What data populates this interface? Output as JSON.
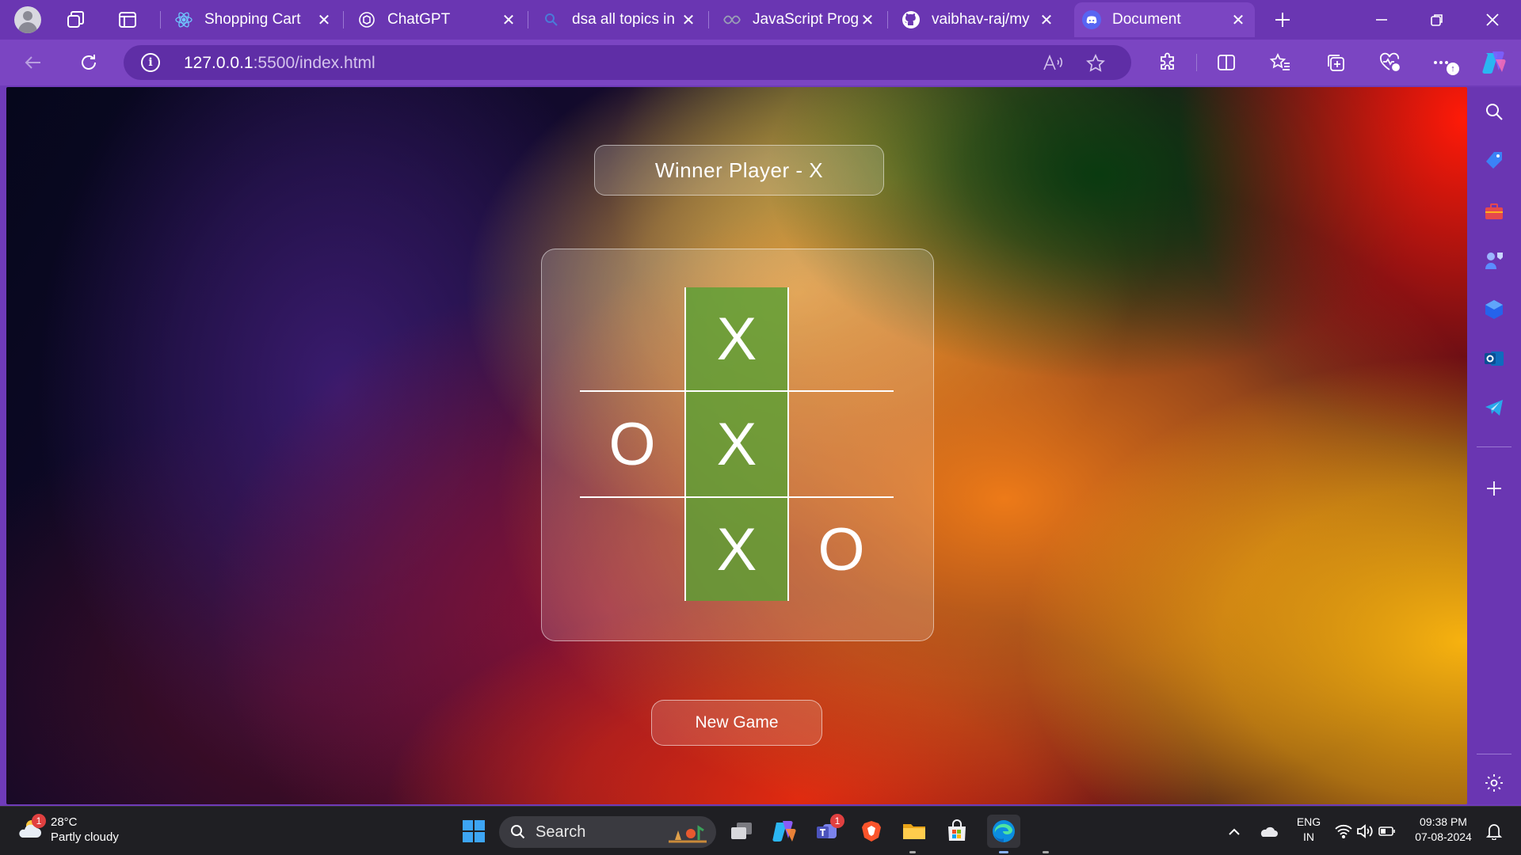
{
  "browser": {
    "tabs": [
      {
        "title": "Shopping Cart",
        "icon": "react-icon",
        "active": false
      },
      {
        "title": "ChatGPT",
        "icon": "chatgpt-icon",
        "active": false
      },
      {
        "title": "dsa all topics in",
        "icon": "search-icon",
        "active": false
      },
      {
        "title": "JavaScript Progr",
        "icon": "js-site-icon",
        "active": false
      },
      {
        "title": "vaibhav-raj/my",
        "icon": "github-icon",
        "active": false
      },
      {
        "title": "Document",
        "icon": "discord-icon",
        "active": true
      }
    ],
    "url_host": "127.0.0.1",
    "url_path": ":5500/index.html",
    "accent": "#7b45c2"
  },
  "game": {
    "status": "Winner Player - X",
    "board": [
      [
        "",
        "X",
        ""
      ],
      [
        "O",
        "X",
        ""
      ],
      [
        "",
        "X",
        "O"
      ]
    ],
    "winning_cells": [
      [
        0,
        1
      ],
      [
        1,
        1
      ],
      [
        2,
        1
      ]
    ],
    "new_game_label": "New Game",
    "win_color": "#5ca034"
  },
  "taskbar": {
    "weather_temp": "28°C",
    "weather_desc": "Partly cloudy",
    "weather_badge": "1",
    "search_label": "Search",
    "teams_badge": "1",
    "lang_line1": "ENG",
    "lang_line2": "IN",
    "time": "09:38 PM",
    "date": "07-08-2024"
  }
}
